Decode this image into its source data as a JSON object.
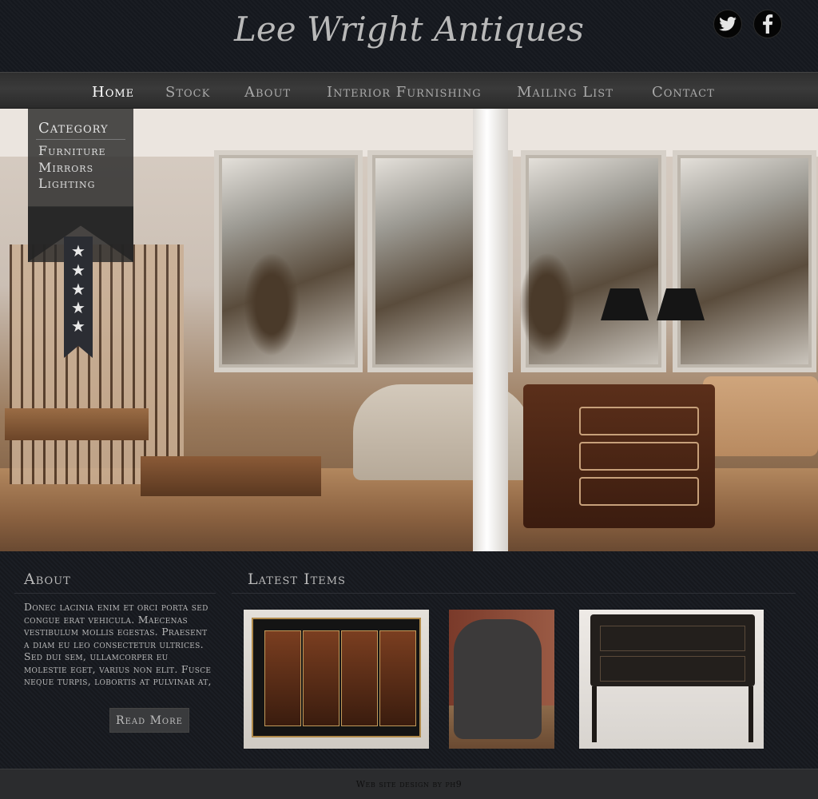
{
  "header": {
    "logo_text": "Lee Wright Antiques",
    "social": [
      {
        "name": "twitter-icon"
      },
      {
        "name": "facebook-icon"
      }
    ]
  },
  "nav": {
    "items": [
      {
        "label": "Home",
        "active": true
      },
      {
        "label": "Stock",
        "active": false
      },
      {
        "label": "About",
        "active": false
      },
      {
        "label": "Interior Furnishing",
        "active": false
      },
      {
        "label": "Mailing List",
        "active": false
      },
      {
        "label": "Contact",
        "active": false
      }
    ]
  },
  "category": {
    "title": "Category",
    "items": [
      "Furniture",
      "Mirrors",
      "Lighting"
    ],
    "star_glyph": "★",
    "stars": 5
  },
  "about": {
    "title": "About",
    "text": "Donec lacinia enim et orci porta sed congue erat vehicula. Maecenas vestibulum mollis egestas. Praesent a diam eu leo consectetur ultrices. Sed dui sem, ullamcorper eu molestie eget, varius non elit. Fusce neque turpis, lobortis at pulvinar at,",
    "read_more_label": "Read More"
  },
  "latest": {
    "title": "Latest Items"
  },
  "footer": {
    "text": "Web site design by ph9"
  },
  "colors": {
    "background": "#15171c",
    "nav_active": "#ffffff",
    "nav_text": "#a9a9a9",
    "button_bg": "#3a3b3d"
  }
}
